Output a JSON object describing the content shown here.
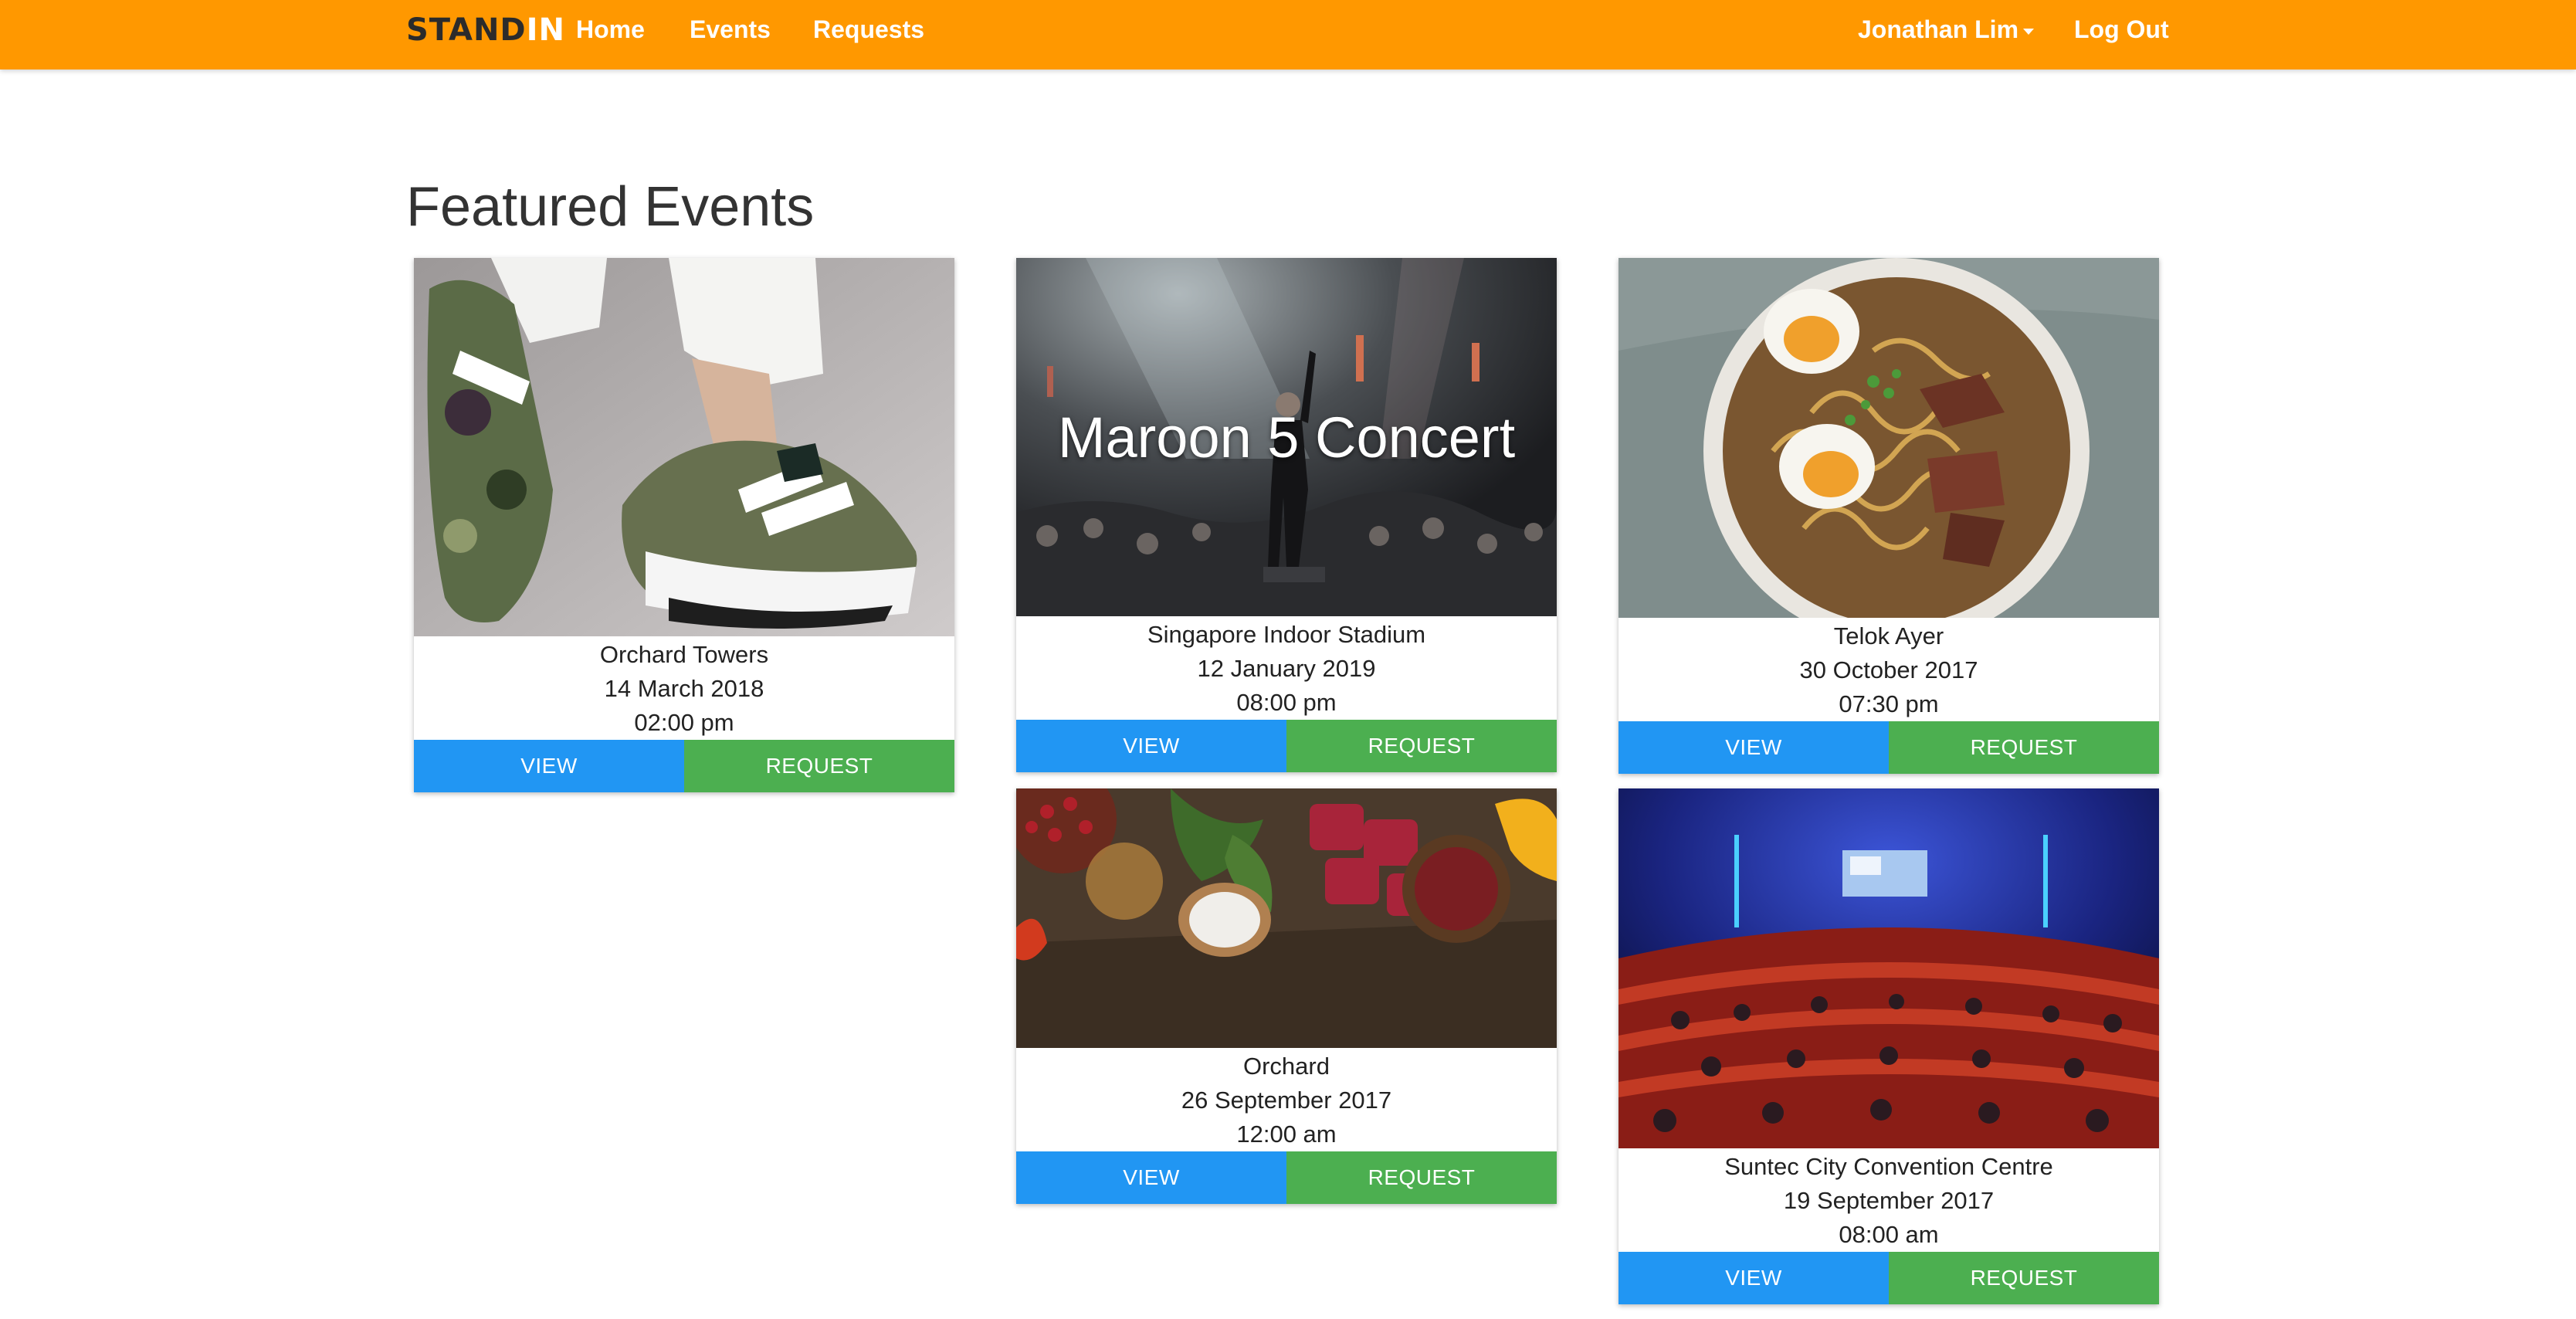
{
  "nav": {
    "brand_part1": "STAND",
    "brand_part2": "IN",
    "links": [
      "Home",
      "Events",
      "Requests"
    ],
    "user_name": "Jonathan Lim",
    "logout_label": "Log Out"
  },
  "page_title": "Featured Events",
  "cards": [
    {
      "image": "sneakers-photo",
      "overlay_text": "",
      "location": "Orchard Towers",
      "date": "14 March 2018",
      "time": "02:00 pm",
      "view_label": "VIEW",
      "request_label": "REQUEST"
    },
    {
      "image": "concert-photo",
      "overlay_text": "Maroon 5 Concert",
      "location": "Singapore Indoor Stadium",
      "date": "12 January 2019",
      "time": "08:00 pm",
      "view_label": "VIEW",
      "request_label": "REQUEST"
    },
    {
      "image": "ramen-photo",
      "overlay_text": "",
      "location": "Telok Ayer",
      "date": "30 October 2017",
      "time": "07:30 pm",
      "view_label": "VIEW",
      "request_label": "REQUEST"
    },
    {
      "image": "spices-meat-photo",
      "overlay_text": "",
      "location": "Orchard",
      "date": "26 September 2017",
      "time": "12:00 am",
      "view_label": "VIEW",
      "request_label": "REQUEST"
    },
    {
      "image": "conference-hall-photo",
      "overlay_text": "",
      "location": "Suntec City Convention Centre",
      "date": "19 September 2017",
      "time": "08:00 am",
      "view_label": "VIEW",
      "request_label": "REQUEST"
    }
  ],
  "colors": {
    "navbar": "#ff9800",
    "view_button": "#2196f3",
    "request_button": "#4caf50"
  }
}
